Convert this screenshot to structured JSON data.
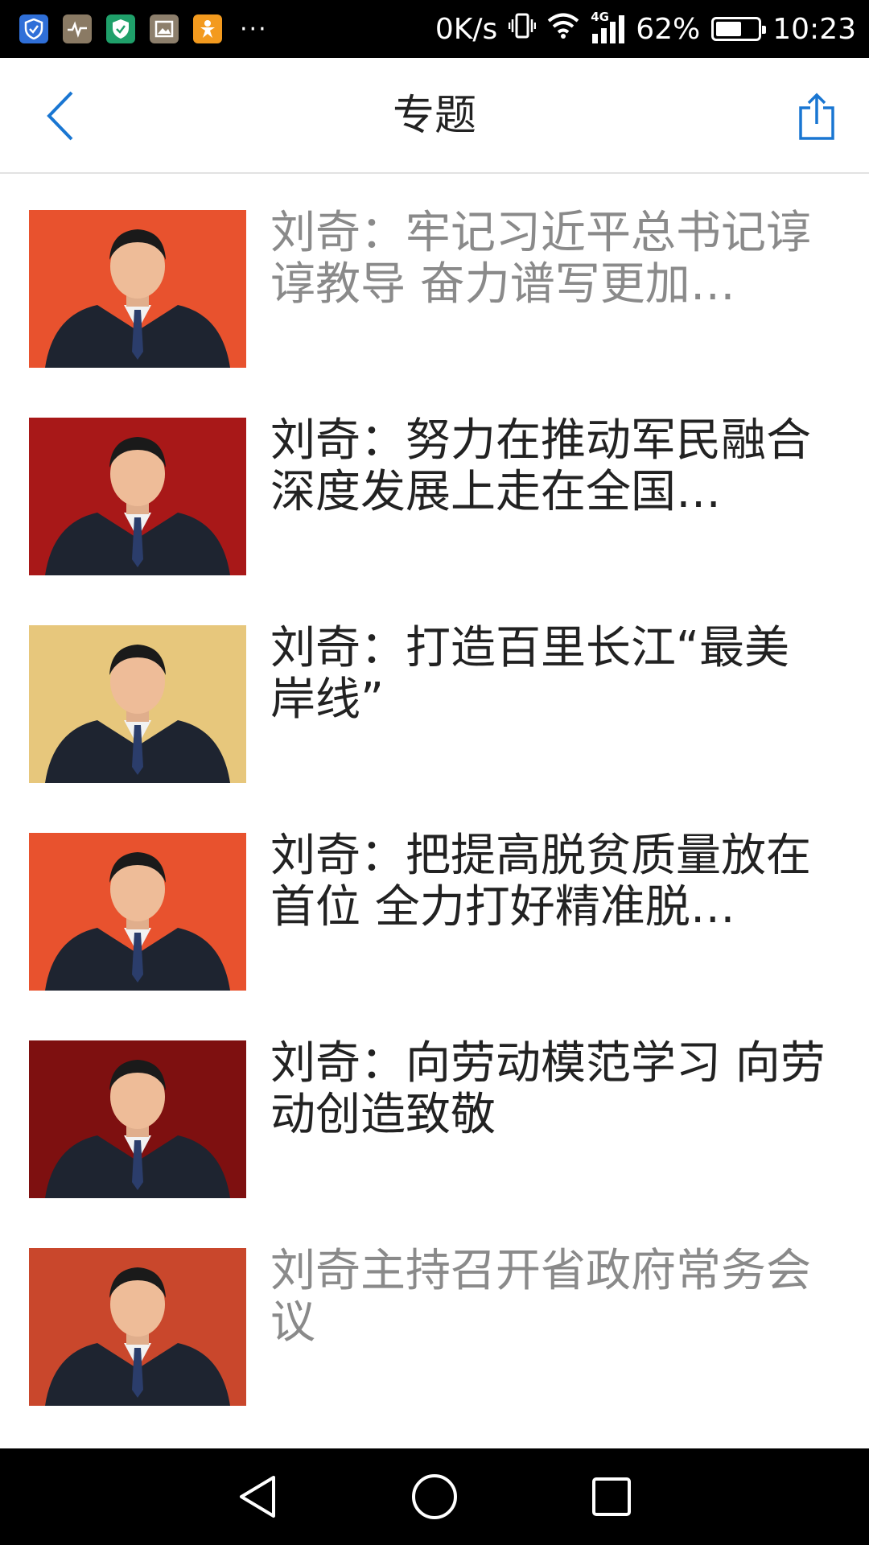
{
  "status_bar": {
    "net_speed": "0K/s",
    "network": "4G",
    "battery_percent": "62%",
    "battery_level": 0.62,
    "time": "10:23",
    "notification_icons": [
      "shield-app-icon",
      "health-app-icon",
      "security-app-icon",
      "gallery-app-icon",
      "person-app-icon"
    ],
    "overflow": "···"
  },
  "header": {
    "title": "专题"
  },
  "articles": [
    {
      "title": "刘奇：牢记习近平总书记谆谆教导 奋力谱写更加…",
      "read": true,
      "bg": "#e8522e"
    },
    {
      "title": "刘奇：努力在推动军民融合深度发展上走在全国…",
      "read": false,
      "bg": "#a81818"
    },
    {
      "title": "刘奇：打造百里长江“最美岸线”",
      "read": false,
      "bg": "#e7c77c"
    },
    {
      "title": "刘奇：把提高脱贫质量放在首位 全力打好精准脱…",
      "read": false,
      "bg": "#e8522e"
    },
    {
      "title": "刘奇：向劳动模范学习 向劳动创造致敬",
      "read": false,
      "bg": "#7e1010"
    },
    {
      "title": "刘奇主持召开省政府常务会议",
      "read": true,
      "bg": "#c9472c"
    }
  ],
  "colors": {
    "accent": "#1976d2",
    "title_unread": "#222222",
    "title_read": "#8a8a8a"
  }
}
